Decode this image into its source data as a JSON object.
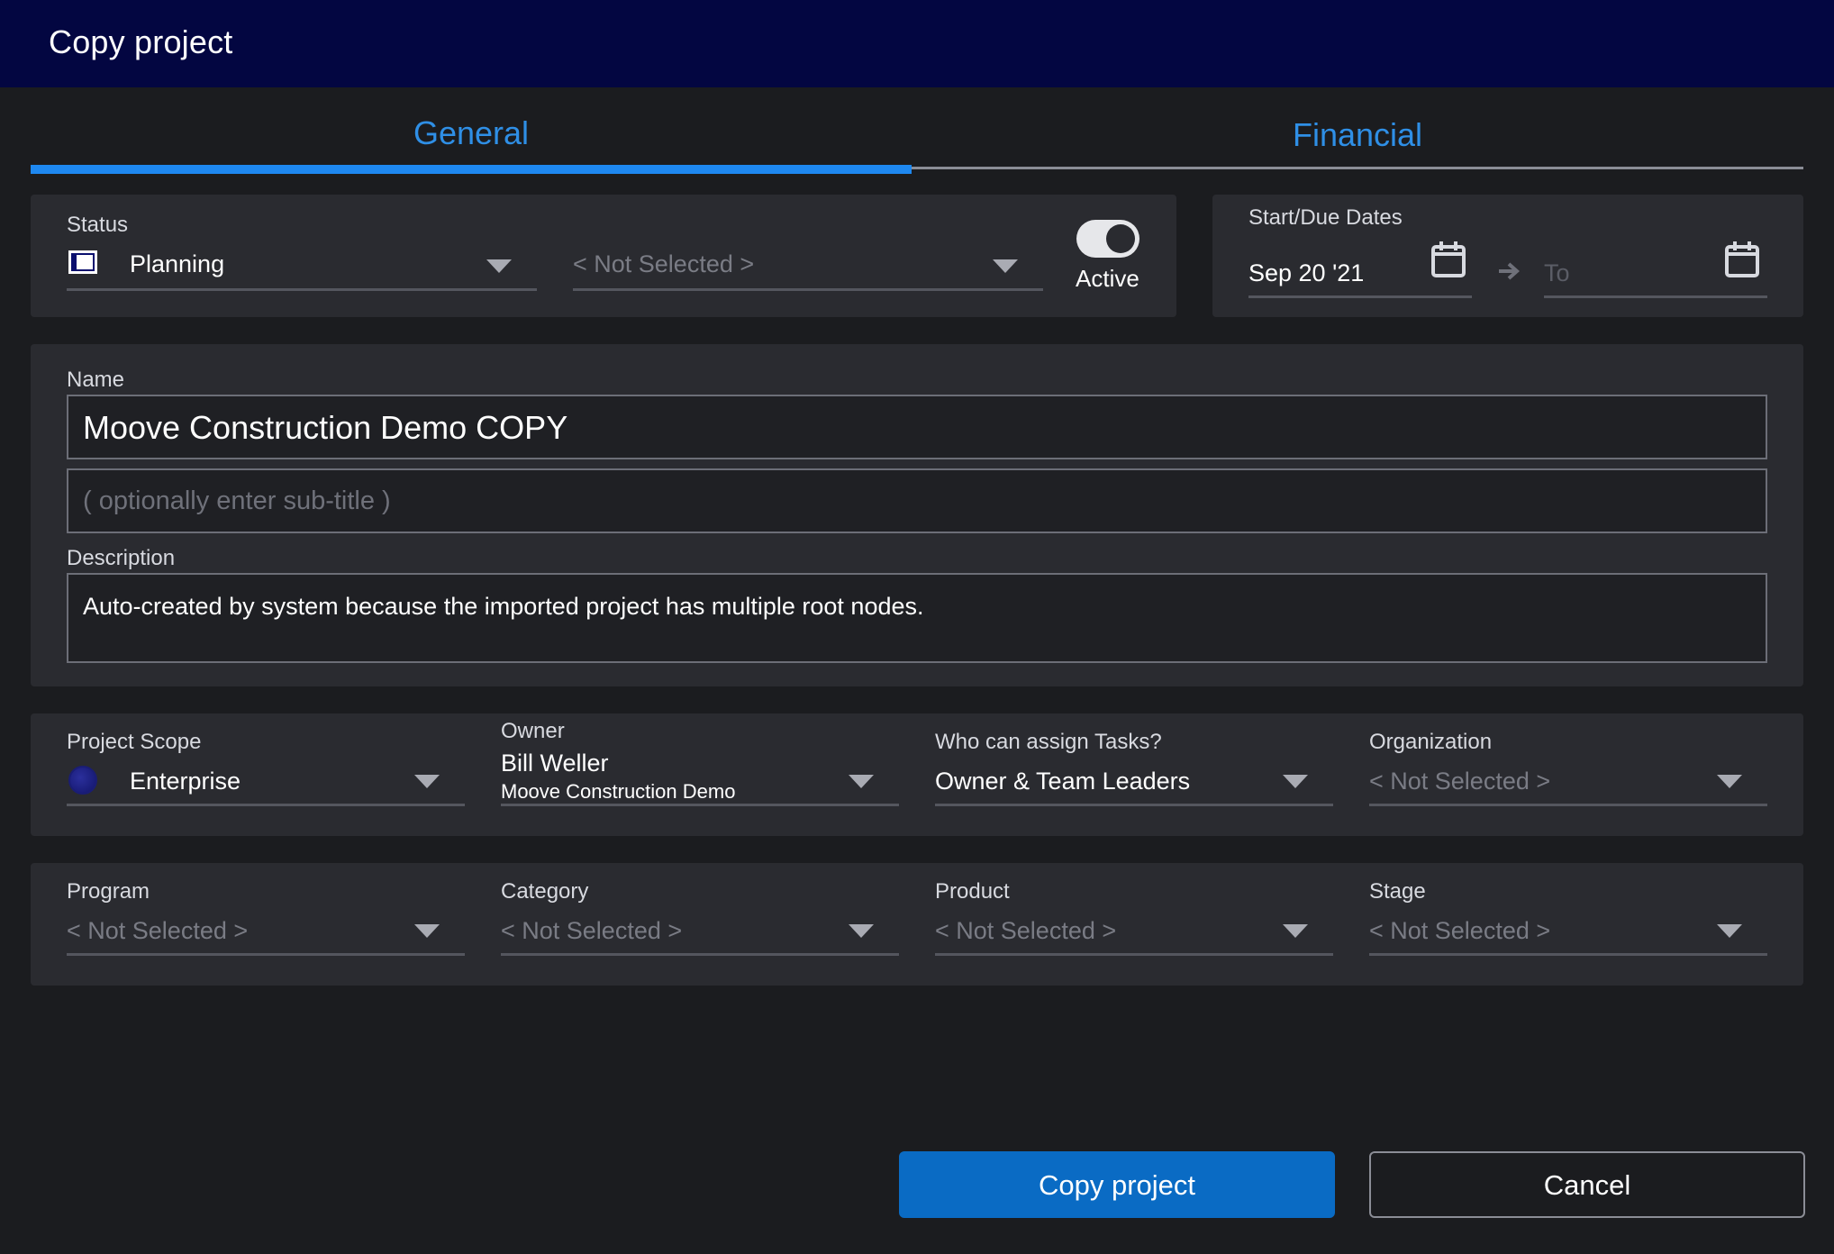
{
  "window": {
    "title": "Copy project"
  },
  "tabs": [
    {
      "label": "General",
      "active": true
    },
    {
      "label": "Financial",
      "active": false
    }
  ],
  "status": {
    "label": "Status",
    "value": "Planning",
    "secondary_placeholder": "< Not Selected >",
    "active_label": "Active",
    "active": true
  },
  "dates": {
    "label": "Start/Due Dates",
    "start": "Sep 20 '21",
    "end_placeholder": "To"
  },
  "name": {
    "label": "Name",
    "value": "Moove Construction Demo COPY",
    "subtitle_placeholder": "( optionally enter sub-title )"
  },
  "description": {
    "label": "Description",
    "value": "Auto-created by system because the imported project has multiple root nodes."
  },
  "project_scope": {
    "label": "Project Scope",
    "value": "Enterprise"
  },
  "owner": {
    "label": "Owner",
    "name": "Bill Weller",
    "org": "Moove Construction Demo"
  },
  "assign_tasks": {
    "label": "Who can assign Tasks?",
    "value": "Owner & Team Leaders"
  },
  "organization": {
    "label": "Organization",
    "placeholder": "< Not Selected >"
  },
  "program": {
    "label": "Program",
    "placeholder": "< Not Selected >"
  },
  "category": {
    "label": "Category",
    "placeholder": "< Not Selected >"
  },
  "product": {
    "label": "Product",
    "placeholder": "< Not Selected >"
  },
  "stage": {
    "label": "Stage",
    "placeholder": "< Not Selected >"
  },
  "actions": {
    "copy_label": "Copy project",
    "cancel_label": "Cancel"
  },
  "colors": {
    "titlebar": "#030641",
    "accent": "#1e88f0",
    "primary_button": "#0a6bc4",
    "panel": "#2a2b30",
    "background": "#1b1c1f"
  }
}
